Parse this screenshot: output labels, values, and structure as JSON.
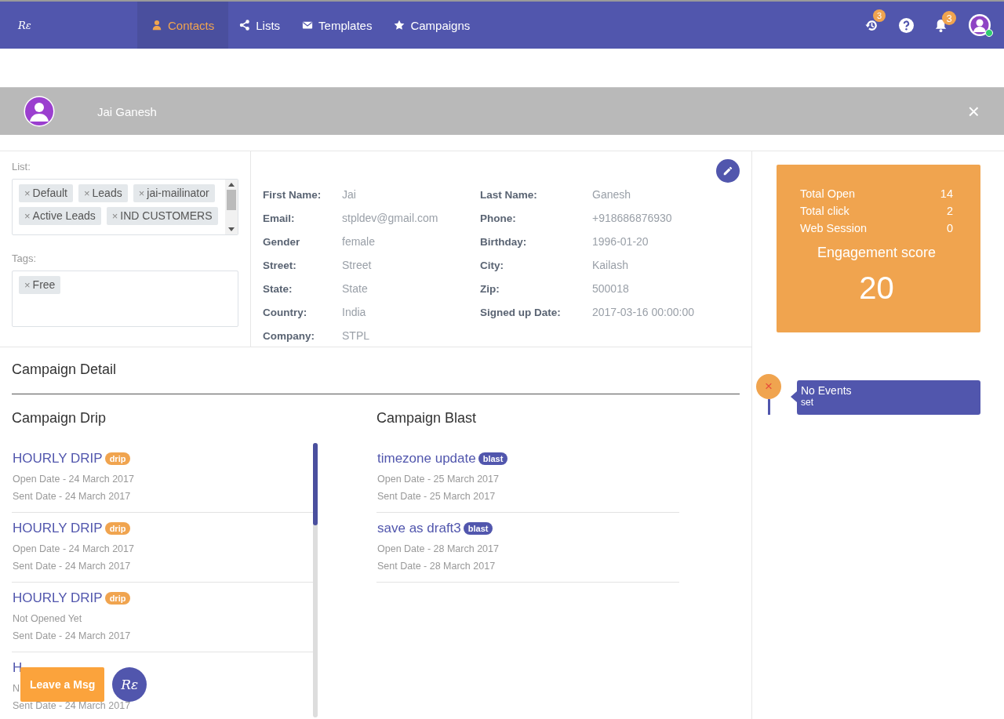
{
  "nav": {
    "logo": "Rε",
    "items": [
      {
        "label": "Contacts",
        "selected": true
      },
      {
        "label": "Lists",
        "selected": false
      },
      {
        "label": "Templates",
        "selected": false
      },
      {
        "label": "Campaigns",
        "selected": false
      }
    ],
    "history_badge": "3",
    "notifications_badge": "3",
    "user_online": true
  },
  "contact_bar": {
    "name": "Jai Ganesh",
    "close": "×"
  },
  "list": {
    "label": "List:",
    "chips": [
      "Default",
      "Leads",
      "jai-mailinator",
      "Active Leads",
      "IND CUSTOMERS"
    ]
  },
  "tags": {
    "label": "Tags:",
    "chips": [
      "Free"
    ]
  },
  "chip_remove": "×",
  "details": [
    {
      "label": "First Name:",
      "value": "Jai"
    },
    {
      "label": "Last Name:",
      "value": "Ganesh"
    },
    {
      "label": "Email:",
      "value": "stpldev@gmail.com"
    },
    {
      "label": "Phone:",
      "value": "+918686876930"
    },
    {
      "label": "Gender",
      "value": "female"
    },
    {
      "label": "Birthday:",
      "value": "1996-01-20"
    },
    {
      "label": "Street:",
      "value": "Street"
    },
    {
      "label": "City:",
      "value": "Kailash"
    },
    {
      "label": "State:",
      "value": "State"
    },
    {
      "label": "Zip:",
      "value": "500018"
    },
    {
      "label": "Country:",
      "value": "India"
    },
    {
      "label": "Signed up Date:",
      "value": "2017-03-16 00:00:00"
    },
    {
      "label": "Company:",
      "value": "STPL"
    }
  ],
  "stats": {
    "rows": [
      {
        "label": "Total Open",
        "value": "14"
      },
      {
        "label": "Total click",
        "value": "2"
      },
      {
        "label": "Web Session",
        "value": "0"
      }
    ],
    "score_label": "Engagement score",
    "score": "20"
  },
  "events": {
    "icon": "×",
    "title": "No Events",
    "subtitle": "set"
  },
  "campaign_detail": {
    "title": "Campaign Detail",
    "drip": {
      "title": "Campaign Drip",
      "items": [
        {
          "name": "HOURLY DRIP",
          "tag": "drip",
          "lines": [
            "Open Date - 24 March 2017",
            "Sent Date - 24 March 2017"
          ]
        },
        {
          "name": "HOURLY DRIP",
          "tag": "drip",
          "lines": [
            "Open Date - 24 March 2017",
            "Sent Date - 24 March 2017"
          ]
        },
        {
          "name": "HOURLY DRIP",
          "tag": "drip",
          "lines": [
            "Not Opened Yet",
            "Sent Date - 24 March 2017"
          ]
        },
        {
          "name": "H",
          "lines": [
            "N",
            "Sent Date - 24 March 2017"
          ]
        }
      ]
    },
    "blast": {
      "title": "Campaign Blast",
      "items": [
        {
          "name": "timezone update",
          "tag": "blast",
          "lines": [
            "Open Date - 25 March 2017",
            "Sent Date - 25 March 2017"
          ]
        },
        {
          "name": "save as draft3",
          "tag": "blast",
          "lines": [
            "Open Date - 28 March 2017",
            "Sent Date - 28 March 2017"
          ]
        }
      ]
    }
  },
  "chat_widget": {
    "label": "Leave a Msg",
    "logo": "Rε"
  }
}
